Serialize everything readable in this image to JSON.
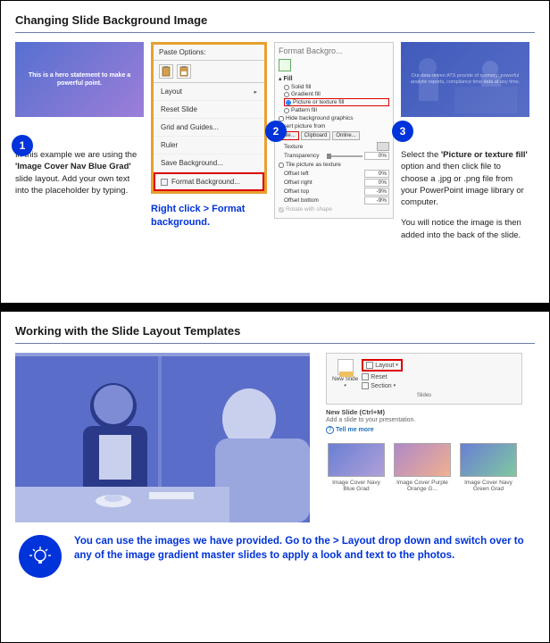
{
  "slide1": {
    "title": "Changing Slide Background Image",
    "hero_text": "This is a hero statement to make a powerful point.",
    "step1_badge": "1",
    "step1_caption_pre": "In this example we are using the ",
    "step1_caption_bold": "'Image Cover Nav Blue Grad'",
    "step1_caption_post": " slide layout. Add your own text into the placeholder by typing.",
    "ctx": {
      "title": "Paste Options:",
      "items": [
        "Layout",
        "Reset Slide",
        "Grid and Guides...",
        "Ruler",
        "Save Background...",
        "Format Background..."
      ]
    },
    "step2_badge": "2",
    "step2_caption": "Right click > Format background.",
    "fb": {
      "title": "Format Backgro...",
      "section": "Fill",
      "r_solid": "Solid fill",
      "r_gradient": "Gradient fill",
      "r_picture": "Picture or texture fill",
      "r_pattern": "Pattern fill",
      "hide_bg": "Hide background graphics",
      "insert_from": "Insert picture from",
      "btn_file": "File...",
      "btn_clip": "Clipboard",
      "btn_online": "Online...",
      "texture": "Texture",
      "transparency": "Transparency",
      "trans_val": "0%",
      "tile": "Tile picture as texture",
      "off_left_l": "Offset left",
      "off_left_v": "0%",
      "off_right_l": "Offset right",
      "off_right_v": "0%",
      "off_top_l": "Offset top",
      "off_top_v": "-9%",
      "off_bottom_l": "Offset bottom",
      "off_bottom_v": "-9%",
      "rotate": "Rotate with shape"
    },
    "ppl_text": "Our data-driven ATS provide of memory: powerful analytic reports, compliance time data at any time.",
    "step3_badge": "3",
    "step3_caption_a": "Select the ",
    "step3_caption_b": "'Picture or texture fill'",
    "step3_caption_c": " option and then click file to choose a .jpg or .png file from your PowerPoint image library or computer.",
    "step3_caption_d": "You will notice the image is then added into the back of the slide."
  },
  "slide2": {
    "title": "Working with the Slide Layout Templates",
    "ribbon": {
      "new_slide": "New Slide",
      "layout": "Layout",
      "reset": "Reset",
      "section": "Section",
      "group": "Slides",
      "tt_title": "New Slide (Ctrl+M)",
      "tt_sub": "Add a slide to your presentation.",
      "tt_link": "Tell me more"
    },
    "thumbs": [
      {
        "label": "Image Cover Navy Blue Grad"
      },
      {
        "label": "Image Cover Purple Orange G..."
      },
      {
        "label": "Image Cover Navy Green Grad"
      }
    ],
    "tip": "You can use the images we have provided. Go to the > Layout drop down and switch over to any of the image gradient master slides to apply a look and text to the photos."
  }
}
